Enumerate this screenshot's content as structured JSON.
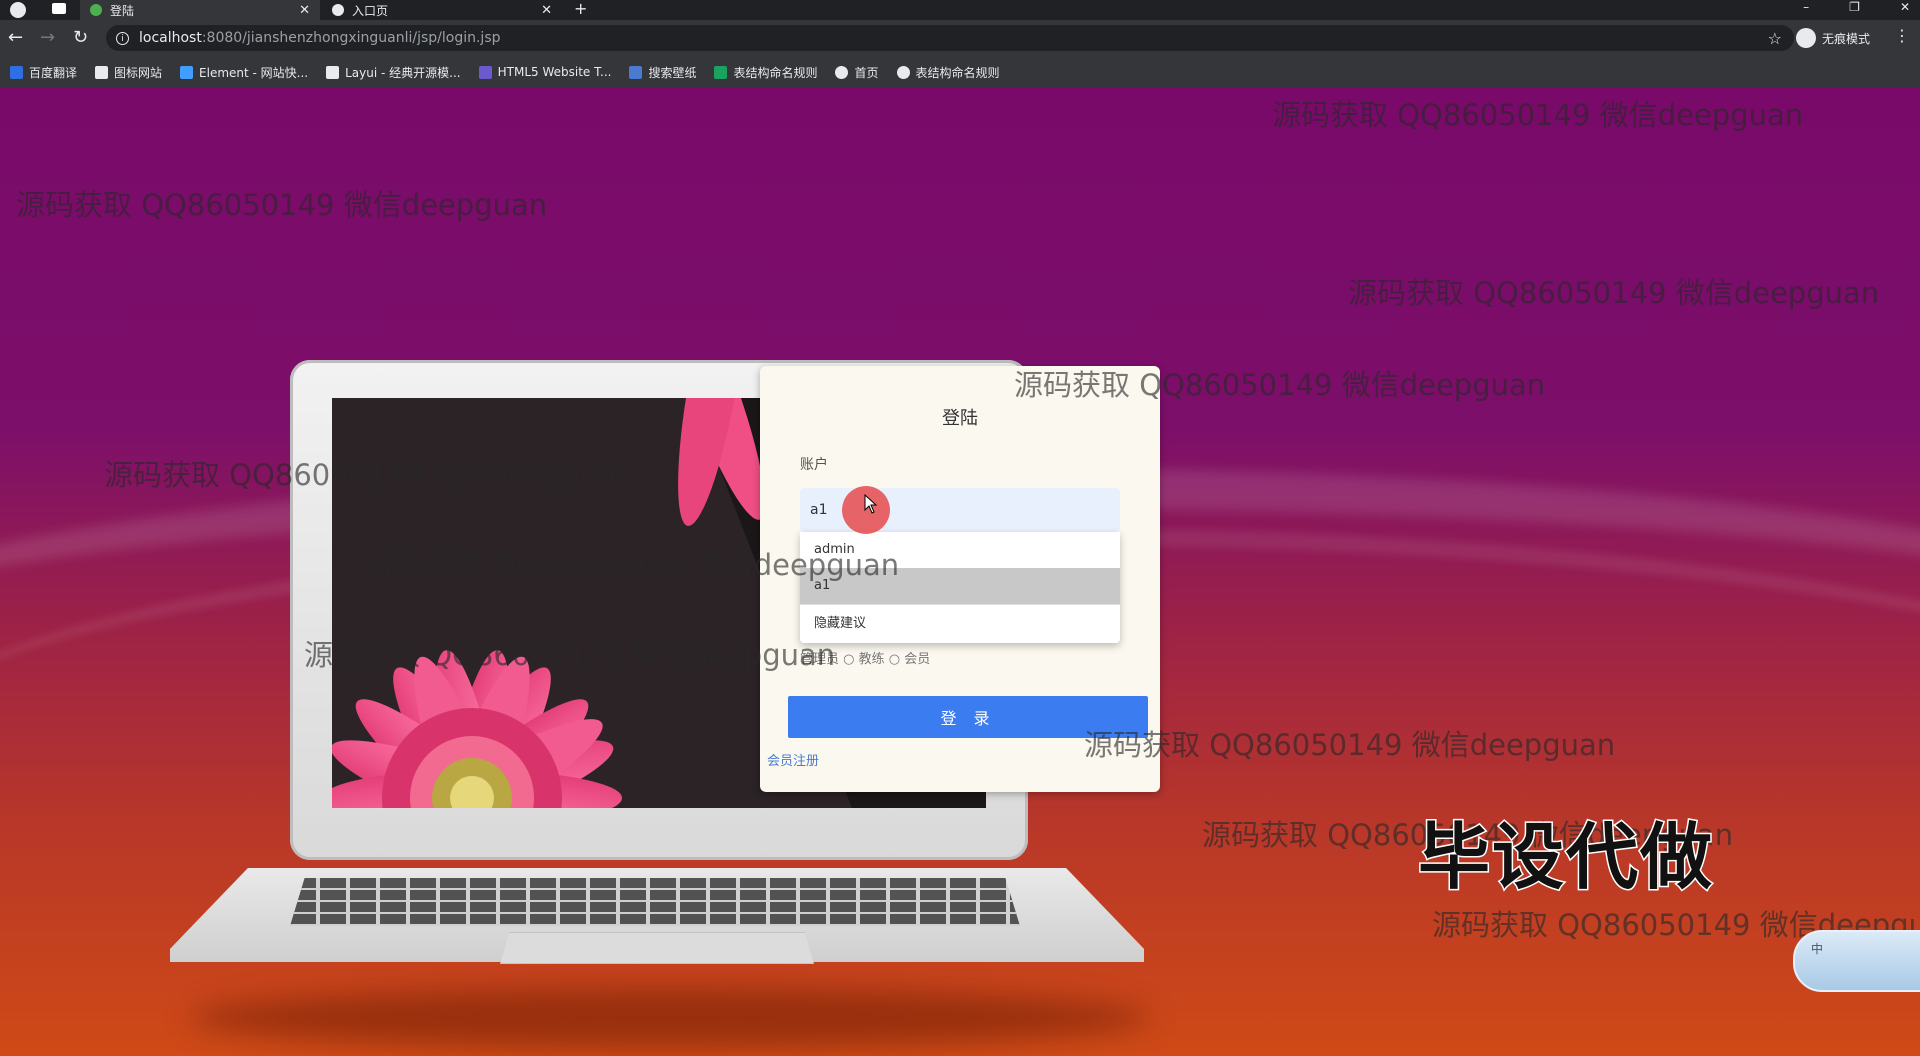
{
  "browser": {
    "tabs": [
      {
        "title": "登陆",
        "active": true
      },
      {
        "title": "入口页",
        "active": false
      }
    ],
    "url_host": "localhost",
    "url_rest": ":8080/jianshenzhongxinguanli/jsp/login.jsp",
    "incognito_label": "无痕模式",
    "bookmarks": [
      {
        "label": "百度翻译",
        "color": "#2f6fe4"
      },
      {
        "label": "图标网站",
        "color": "#e8eaed"
      },
      {
        "label": "Element - 网站快...",
        "color": "#409eff"
      },
      {
        "label": "Layui - 经典开源模...",
        "color": "#e8eaed"
      },
      {
        "label": "HTML5 Website T...",
        "color": "#6a5acd"
      },
      {
        "label": "搜索壁纸",
        "color": "#4a7bd0"
      },
      {
        "label": "表结构命名规则",
        "color": "#1aa260"
      },
      {
        "label": "首页",
        "color": "#e8eaed"
      },
      {
        "label": "表结构命名规则",
        "color": "#e8eaed"
      }
    ]
  },
  "login": {
    "title": "登陆",
    "account_label": "账户",
    "account_value": "a1",
    "autocomplete": [
      "admin",
      "a1"
    ],
    "autocomplete_footer": "隐藏建议",
    "roles_partial": "管理员 ○ 教练 ○ 会员",
    "login_button": "登 录",
    "register_link": "会员注册"
  },
  "overlay": {
    "watermark": "源码获取 QQ86050149 微信deepguan",
    "watermark_cut": "源码获取 QQ86050149 微信deepgu",
    "big_text": "毕设代做",
    "ime_label": "中"
  },
  "colors": {
    "accent": "#3b7cf0",
    "chrome_dark": "#202124",
    "chrome": "#35363a"
  }
}
